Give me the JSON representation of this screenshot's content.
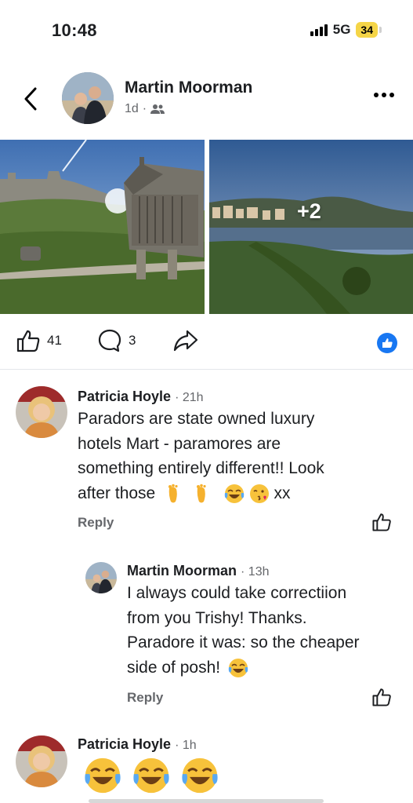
{
  "status_bar": {
    "time": "10:48",
    "network": "5G",
    "battery": "34"
  },
  "post": {
    "author": "Martin Moorman",
    "age": "1d",
    "separator": "·",
    "audience_icon": "friends-icon",
    "more_photos": "+2"
  },
  "actions": {
    "like_count": "41",
    "comment_count": "3"
  },
  "comments": [
    {
      "author": "Patricia Hoyle",
      "time": "· 21h",
      "lines": [
        "Paradors are state owned luxury",
        "hotels Mart - paramores are",
        "something entirely different!! Look",
        "after those"
      ],
      "tail_text": "xx",
      "reply_label": "Reply"
    },
    {
      "author": "Martin Moorman",
      "time": "· 13h",
      "lines": [
        "I always could take correctiion",
        "from you Trishy! Thanks.",
        "Paradore it was: so the cheaper",
        "side of posh!"
      ],
      "reply_label": "Reply"
    },
    {
      "author": "Patricia Hoyle",
      "time": "· 1h"
    }
  ],
  "colors": {
    "accent": "#1877f2",
    "secondary_text": "#65676b",
    "divider": "#e4e6eb"
  }
}
